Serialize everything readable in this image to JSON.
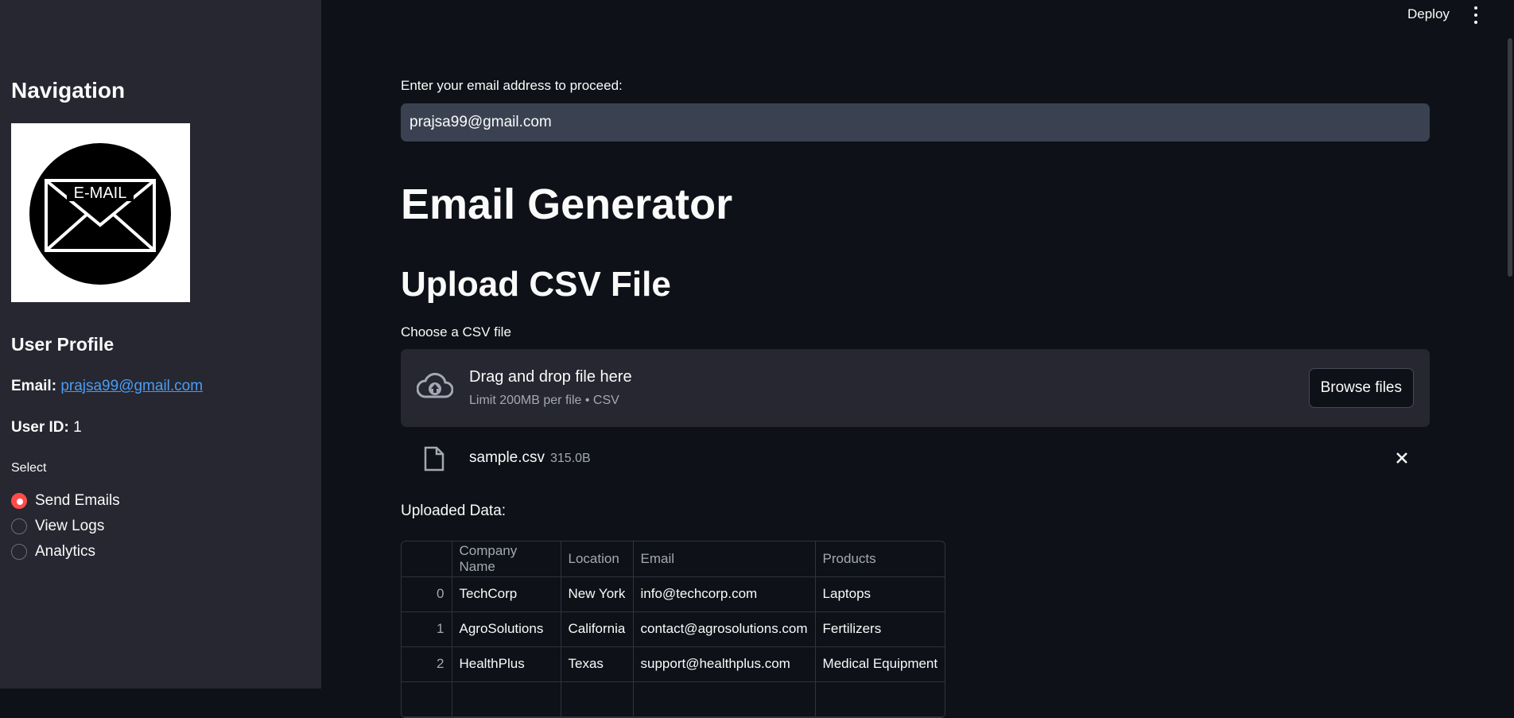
{
  "header": {
    "deploy_label": "Deploy"
  },
  "sidebar": {
    "title": "Navigation",
    "logo_text": "E-MAIL",
    "profile_heading": "User Profile",
    "email_label": "Email:",
    "email_value": "prajsa99@gmail.com",
    "userid_label": "User ID:",
    "userid_value": "1",
    "select_label": "Select",
    "options": [
      {
        "label": "Send Emails",
        "checked": true
      },
      {
        "label": "View Logs",
        "checked": false
      },
      {
        "label": "Analytics",
        "checked": false
      }
    ]
  },
  "main": {
    "email_prompt": "Enter your email address to proceed:",
    "email_value": "prajsa99@gmail.com",
    "title": "Email Generator",
    "upload_heading": "Upload CSV File",
    "choose_label": "Choose a CSV file",
    "dropzone": {
      "title": "Drag and drop file here",
      "limit": "Limit 200MB per file • CSV",
      "browse_label": "Browse files"
    },
    "file": {
      "name": "sample.csv",
      "size": "315.0B"
    },
    "uploaded_label": "Uploaded Data:",
    "table": {
      "columns": [
        "",
        "Company Name",
        "Location",
        "Email",
        "Products"
      ],
      "rows": [
        [
          "0",
          "TechCorp",
          "New York",
          "info@techcorp.com",
          "Laptops"
        ],
        [
          "1",
          "AgroSolutions",
          "California",
          "contact@agrosolutions.com",
          "Fertilizers"
        ],
        [
          "2",
          "HealthPlus",
          "Texas",
          "support@healthplus.com",
          "Medical Equipment"
        ]
      ]
    }
  },
  "colors": {
    "background": "#0e1117",
    "sidebar": "#262730",
    "accent": "#ff4b4b",
    "link": "#4a9cf6"
  }
}
